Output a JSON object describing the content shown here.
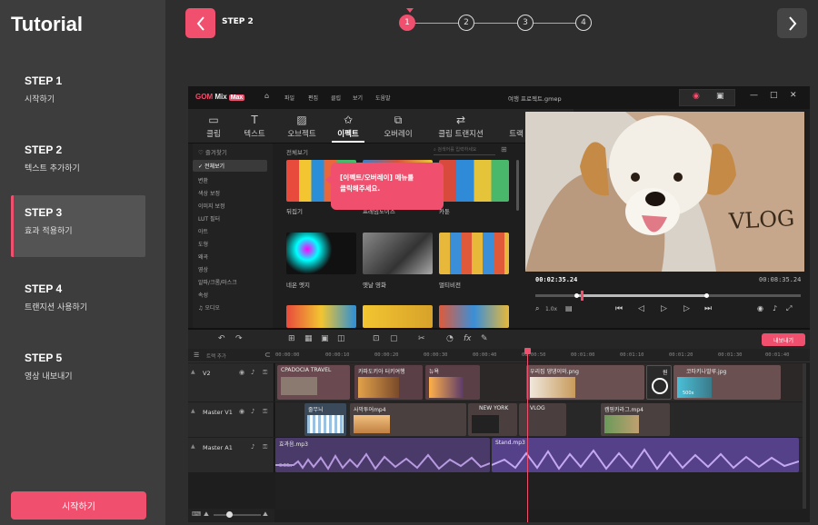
{
  "sidebar": {
    "title": "Tutorial",
    "steps": [
      {
        "label": "STEP 1",
        "desc": "시작하기"
      },
      {
        "label": "STEP 2",
        "desc": "텍스트 추가하기"
      },
      {
        "label": "STEP 3",
        "desc": "효과 적용하기"
      },
      {
        "label": "STEP 4",
        "desc": "트랜지션 사용하기"
      },
      {
        "label": "STEP 5",
        "desc": "영상 내보내기"
      }
    ],
    "active_step": 3,
    "start_button": "시작하기"
  },
  "header": {
    "step_label": "STEP 2",
    "progress": [
      "1",
      "2",
      "3",
      "4"
    ],
    "current": 1,
    "back_icon": "chevron-left-icon",
    "next_icon": "chevron-right-icon"
  },
  "app": {
    "logo_brand": "GOM",
    "logo_product": "Mix",
    "logo_badge": "Max",
    "menu": [
      "파일",
      "편집",
      "클립",
      "보기",
      "도움말"
    ],
    "project_name": "여행 프로젝트.gmep",
    "categories": [
      {
        "label": "클립",
        "icon": "clip-icon"
      },
      {
        "label": "텍스트",
        "icon": "text-icon"
      },
      {
        "label": "오브젝트",
        "icon": "object-icon"
      },
      {
        "label": "이펙트",
        "icon": "effect-icon"
      },
      {
        "label": "오버레이",
        "icon": "overlay-icon"
      },
      {
        "label": "클립 트랜지션",
        "icon": "clip-transition-icon"
      },
      {
        "label": "트랙 트랜지션",
        "icon": "track-transition-icon"
      }
    ],
    "selected_category": "이펙트",
    "filters": {
      "favorite": "즐겨찾기",
      "items": [
        "전체보기",
        "변환",
        "색상 보정",
        "이미지 보정",
        "LUT 필터",
        "아트",
        "도형",
        "왜곡",
        "영상",
        "알파/크롬/마스크",
        "속성",
        "오디오"
      ],
      "selected": "전체보기"
    },
    "browser": {
      "title": "전체보기",
      "search_placeholder": "검색어를 입력하세요",
      "thumbs": [
        "뒤집기",
        "프레임노이즈",
        "카툰",
        "네온 엣지",
        "옛날 영화",
        "멀티비전",
        "",
        "",
        ""
      ]
    },
    "tooltip": "[이펙트/오버레이] 메뉴를\n클릭해주세요.",
    "preview": {
      "overlay_text": "VLOG",
      "timecode": "00:02:35.24",
      "duration": "00:08:35.24",
      "playback_position": 0.17,
      "speed": "1.0x"
    },
    "export_button": "내보내기",
    "track_label": "트랙 추가",
    "ruler": [
      "00:00:00",
      "00:00:10",
      "00:00:20",
      "00:00:30",
      "00:00:40",
      "00:00:50",
      "00:01:00",
      "00:01:10",
      "00:01:20",
      "00:01:30",
      "00:01:40"
    ],
    "tracks": [
      {
        "name": "V2",
        "clips": [
          "CPADOCIA TRAVEL",
          "카파도키아 터키여행",
          "뉴욕",
          "우리집 댕댕이와.png",
          "원",
          "코타키나발루.jpg"
        ]
      },
      {
        "name": "Master V1",
        "clips": [
          "줄무늬",
          "사막투어mp4",
          "NEW YORK",
          "VLOG",
          "캠핑카라그.mp4"
        ]
      },
      {
        "name": "Master A1",
        "clips": [
          "효과음.mp3",
          "Stand.mp3"
        ]
      }
    ],
    "clip_badges": [
      "0.66x",
      "500x"
    ]
  }
}
